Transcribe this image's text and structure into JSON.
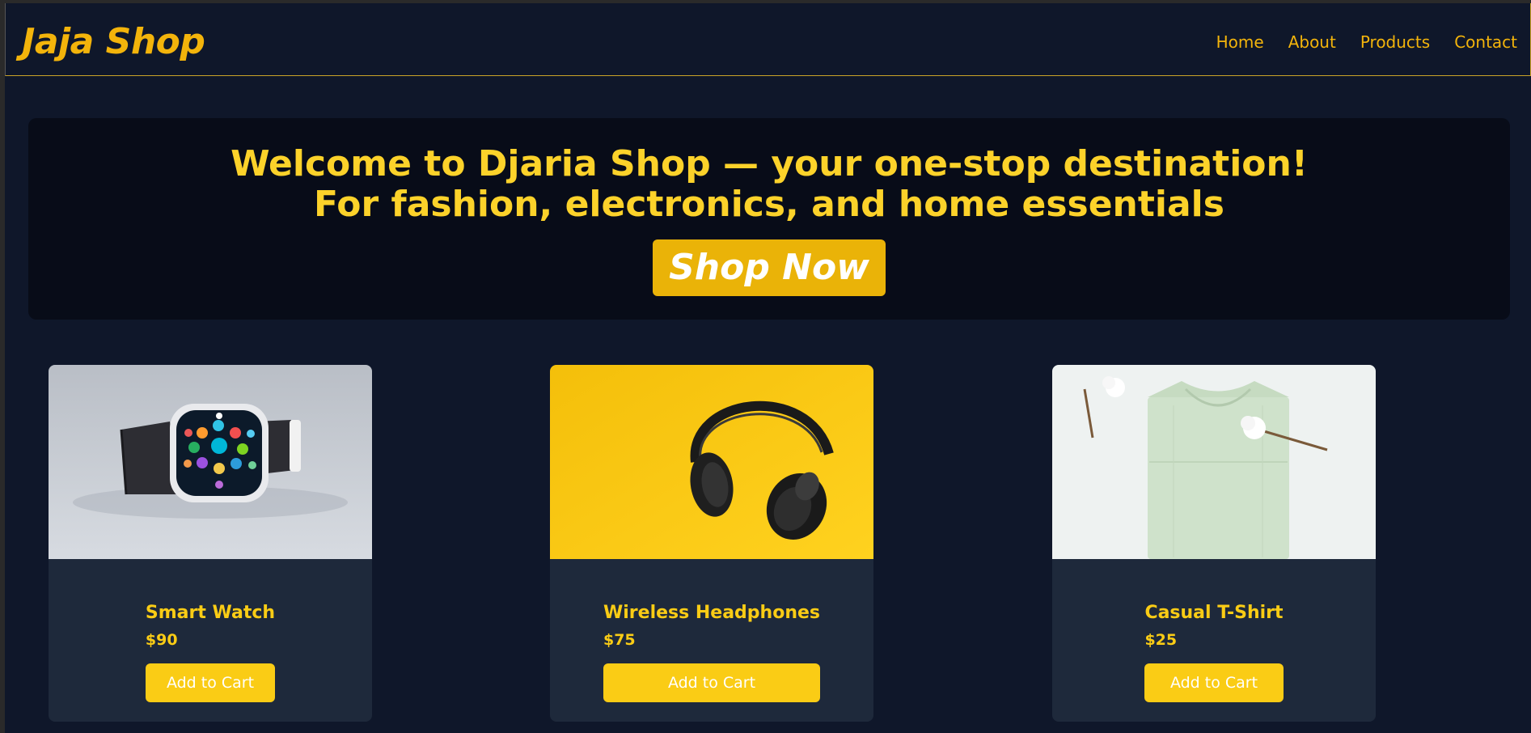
{
  "header": {
    "brand": "Jaja Shop",
    "nav": [
      "Home",
      "About",
      "Products",
      "Contact"
    ]
  },
  "hero": {
    "line1": "Welcome to Djaria Shop — your one-stop destination!",
    "line2": "For fashion, electronics, and home essentials",
    "cta": "Shop Now"
  },
  "products": [
    {
      "name": "Smart Watch",
      "price": "$90",
      "button": "Add to Cart",
      "image": "smartwatch-photo"
    },
    {
      "name": "Wireless Headphones",
      "price": "$75",
      "button": "Add to Cart",
      "image": "headphones-photo"
    },
    {
      "name": "Casual T-Shirt",
      "price": "$25",
      "button": "Add to Cart",
      "image": "tshirt-photo"
    }
  ],
  "colors": {
    "background": "#0f172a",
    "accent": "#facc15",
    "card": "#1e293b",
    "hero": "#080c18"
  }
}
